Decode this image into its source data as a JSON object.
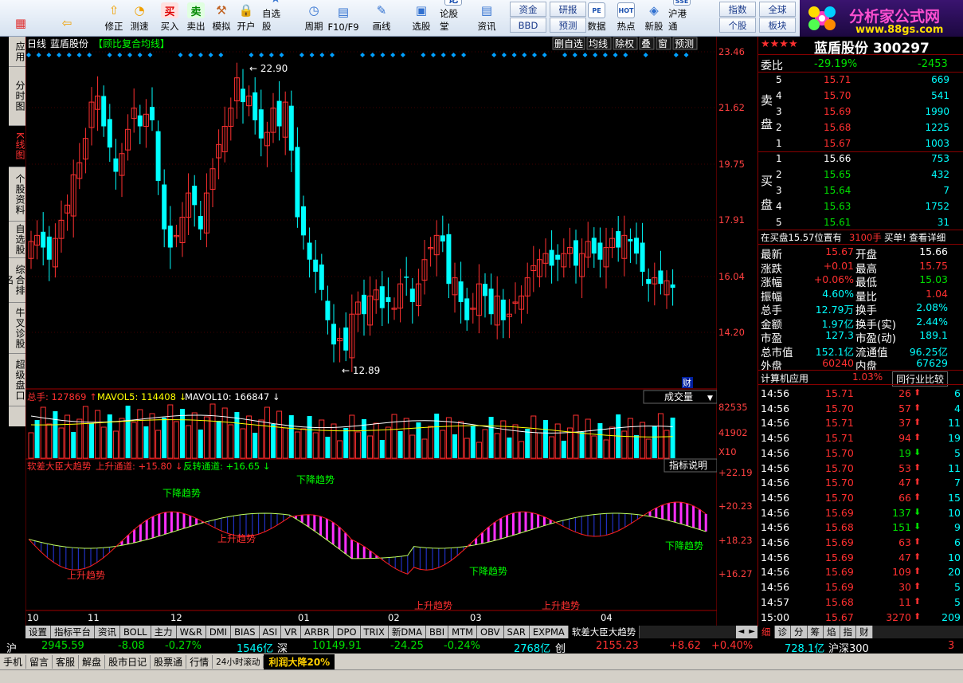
{
  "toolbar": {
    "buttons": [
      {
        "label": "",
        "icon": "grid-icon"
      },
      {
        "label": "",
        "icon": "back-arrow-icon"
      },
      {
        "label": "修正",
        "icon": "up-arrow-icon"
      },
      {
        "label": "测速",
        "icon": "clock-icon"
      },
      {
        "label": "买入",
        "glyph": "买"
      },
      {
        "label": "卖出",
        "glyph": "卖"
      },
      {
        "label": "模拟",
        "icon": "hammer-icon"
      },
      {
        "label": "开户",
        "icon": "lock-icon"
      },
      {
        "label": "自选股",
        "icon": "star-icon"
      },
      {
        "label": "周期",
        "icon": "cycle-icon"
      },
      {
        "label": "F10/F9",
        "icon": "f10-icon"
      },
      {
        "label": "画线",
        "icon": "pen-icon"
      },
      {
        "label": "选股",
        "icon": "monitor-icon"
      },
      {
        "label": "论股堂",
        "glyph": "论"
      },
      {
        "label": "资讯",
        "icon": "doc-icon"
      },
      {
        "label": "数据",
        "glyph": "PE"
      },
      {
        "label": "热点",
        "glyph": "HOT"
      },
      {
        "label": "新股",
        "icon": "newstock-icon"
      },
      {
        "label": "沪港通",
        "glyph": "SSE"
      }
    ],
    "small": [
      "资金",
      "研报",
      "指数",
      "全球",
      "BBD",
      "预测",
      "个股",
      "板块"
    ]
  },
  "logo": {
    "title": "分析家公式网",
    "url": "www.88gs.com"
  },
  "left_tabs": [
    "应用",
    "分时图",
    "K线图",
    "个股资料",
    "自选股",
    "综合排名",
    "牛叉诊股",
    "超级盘口"
  ],
  "chart_header": {
    "period": "日线",
    "stock": "蓝盾股份",
    "indicator": "【顾比复合均线】",
    "buttons": [
      "删自选",
      "均线",
      "除权",
      "叠",
      "窗",
      "预测"
    ]
  },
  "price_axis": [
    "23.46",
    "21.62",
    "19.75",
    "17.91",
    "16.04",
    "14.20"
  ],
  "price_labels": {
    "high": "22.90",
    "low": "12.89"
  },
  "fin_badge": "财",
  "volume": {
    "label": "总手: 127869",
    "ma5": "MAVOL5: 114408",
    "ma10": "MAVOL10: 166847",
    "dropdown": "成交量",
    "axis": [
      "82535",
      "41902",
      "X10"
    ]
  },
  "indicator": {
    "name": "软差大臣大趋势",
    "up": "上升通道: +15.80",
    "rev": "反转通道: +16.65",
    "help": "指标说明",
    "axis": [
      "+22.19",
      "+20.23",
      "+18.23",
      "+16.27"
    ],
    "labels": [
      {
        "text": "上升趋势",
        "c": "#ff3030"
      },
      {
        "text": "下降趋势",
        "c": "#00ff00"
      },
      {
        "text": "上升趋势",
        "c": "#ff3030"
      },
      {
        "text": "下降趋势",
        "c": "#00ff00"
      },
      {
        "text": "上升趋势",
        "c": "#ff3030"
      },
      {
        "text": "下降趋势",
        "c": "#00ff00"
      },
      {
        "text": "上升趋势",
        "c": "#ff3030"
      },
      {
        "text": "下降趋势",
        "c": "#00ff00"
      }
    ]
  },
  "x_axis": [
    "10",
    "11",
    "12",
    "01",
    "02",
    "03",
    "04"
  ],
  "bottom_tabs": [
    "设置",
    "指标平台",
    "资讯",
    "BOLL",
    "主力",
    "W&R",
    "DMI",
    "BIAS",
    "ASI",
    "VR",
    "ARBR",
    "DPO",
    "TRIX",
    "新DMA",
    "BBI",
    "MTM",
    "OBV",
    "SAR",
    "EXPMA",
    "软差大臣大趋势"
  ],
  "quote": {
    "stars": "★★★★",
    "name": "蓝盾股份 300297",
    "weibi_label": "委比",
    "weibi": "-29.19%",
    "weicha": "-2453",
    "sell_label": "卖盘",
    "buy_label": "买盘",
    "sell": [
      {
        "n": "5",
        "p": "15.71",
        "v": "669"
      },
      {
        "n": "4",
        "p": "15.70",
        "v": "541"
      },
      {
        "n": "3",
        "p": "15.69",
        "v": "1990"
      },
      {
        "n": "2",
        "p": "15.68",
        "v": "1225"
      },
      {
        "n": "1",
        "p": "15.67",
        "v": "1003"
      }
    ],
    "buy": [
      {
        "n": "1",
        "p": "15.66",
        "v": "753"
      },
      {
        "n": "2",
        "p": "15.65",
        "v": "432"
      },
      {
        "n": "3",
        "p": "15.64",
        "v": "7"
      },
      {
        "n": "4",
        "p": "15.63",
        "v": "1752"
      },
      {
        "n": "5",
        "p": "15.61",
        "v": "31"
      }
    ],
    "notice": "在买盘15.57位置有",
    "notice_vol": "3100手",
    "notice_tail": "买单! 查看详细",
    "stats": [
      [
        "最新",
        "15.67",
        "开盘",
        "15.66"
      ],
      [
        "涨跌",
        "+0.01",
        "最高",
        "15.75"
      ],
      [
        "涨幅",
        "+0.06%",
        "最低",
        "15.03"
      ],
      [
        "振幅",
        "4.60%",
        "量比",
        "1.04"
      ],
      [
        "总手",
        "12.79万",
        "换手",
        "2.08%"
      ],
      [
        "金额",
        "1.97亿",
        "换手(实)",
        "2.44%"
      ],
      [
        "市盈",
        "127.3",
        "市盈(动)",
        "189.1"
      ],
      [
        "总市值",
        "152.1亿",
        "流通值",
        "96.25亿"
      ],
      [
        "外盘",
        "60240",
        "内盘",
        "67629"
      ]
    ],
    "industry": "计算机应用",
    "industry_pct": "1.03%",
    "industry_btn": "同行业比较",
    "ticks": [
      [
        "14:56",
        "15.71",
        "26",
        "6"
      ],
      [
        "14:56",
        "15.70",
        "57",
        "4"
      ],
      [
        "14:56",
        "15.71",
        "37",
        "11"
      ],
      [
        "14:56",
        "15.71",
        "94",
        "19"
      ],
      [
        "14:56",
        "15.70",
        "19",
        "5"
      ],
      [
        "14:56",
        "15.70",
        "53",
        "11"
      ],
      [
        "14:56",
        "15.70",
        "47",
        "7"
      ],
      [
        "14:56",
        "15.70",
        "66",
        "15"
      ],
      [
        "14:56",
        "15.69",
        "137",
        "10"
      ],
      [
        "14:56",
        "15.68",
        "151",
        "9"
      ],
      [
        "14:56",
        "15.69",
        "63",
        "6"
      ],
      [
        "14:56",
        "15.69",
        "47",
        "10"
      ],
      [
        "14:56",
        "15.69",
        "109",
        "20"
      ],
      [
        "14:56",
        "15.69",
        "30",
        "5"
      ],
      [
        "14:57",
        "15.68",
        "11",
        "5"
      ],
      [
        "15:00",
        "15.67",
        "3270",
        "209"
      ]
    ],
    "tabs": [
      "细",
      "诊",
      "分",
      "筹",
      "焰",
      "指",
      "财"
    ]
  },
  "status": {
    "sh_label": "沪",
    "sh": "2945.59",
    "sh_chg": "-8.08",
    "sh_pct": "-0.27%",
    "sh_amt": "1546亿",
    "sz_label": "深",
    "sz": "10149.91",
    "sz_chg": "-24.25",
    "sz_pct": "-0.24%",
    "sz_amt": "2768亿",
    "cy_label": "创",
    "cy": "2155.23",
    "cy_chg": "+8.62",
    "cy_pct": "+0.40%",
    "cy_amt": "728.1亿",
    "hs_label": "沪深300",
    "hs": "3"
  },
  "status2": [
    "手机",
    "留言",
    "客服",
    "解盘",
    "股市日记",
    "股票通",
    "行情",
    "24小时滚动"
  ],
  "news": "利润大降20%"
}
